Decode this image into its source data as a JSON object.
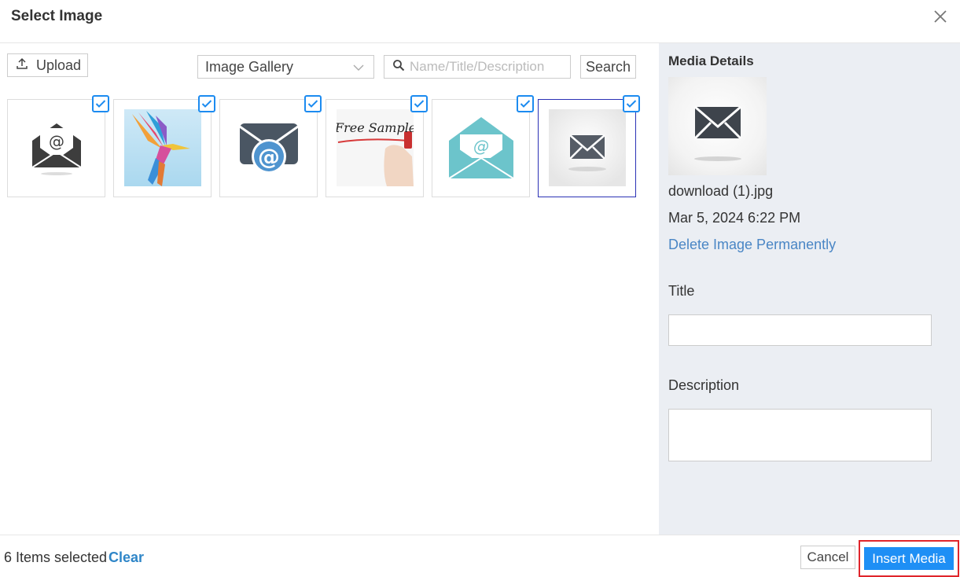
{
  "dialog": {
    "title": "Select Image"
  },
  "toolbar": {
    "upload_label": "Upload",
    "gallery_selected": "Image Gallery",
    "search_placeholder": "Name/Title/Description",
    "search_value": "",
    "search_button": "Search"
  },
  "gallery": {
    "items": [
      {
        "image": "open-envelope-at-icon",
        "selected": true
      },
      {
        "image": "colorful-hummingbird-image",
        "selected": true
      },
      {
        "image": "envelope-at-icon",
        "selected": true
      },
      {
        "image": "free-sample-handwriting-image",
        "selected": true,
        "text": "Free Sample"
      },
      {
        "image": "teal-envelope-at-icon",
        "selected": true
      },
      {
        "image": "grey-envelope-icon",
        "selected": true,
        "active": true
      }
    ]
  },
  "details": {
    "heading": "Media Details",
    "file_name": "download (1).jpg",
    "date": "Mar 5, 2024 6:22 PM",
    "delete_label": "Delete Image Permanently",
    "title_label": "Title",
    "title_value": "",
    "description_label": "Description",
    "description_value": ""
  },
  "footer": {
    "selected_count": "6 Items selected",
    "clear_label": "Clear",
    "cancel_label": "Cancel",
    "insert_label": "Insert Media"
  },
  "colors": {
    "accent": "#1e8ff5",
    "check": "#1c8bf0",
    "link": "#4a86c5",
    "panel_bg": "#ebeef3",
    "highlight": "#e0252b"
  }
}
